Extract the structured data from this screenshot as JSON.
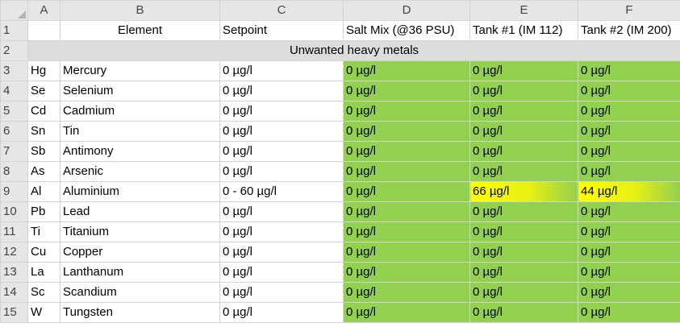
{
  "columns": [
    "A",
    "B",
    "C",
    "D",
    "E",
    "F"
  ],
  "header_row": {
    "num": "1",
    "element": "Element",
    "setpoint": "Setpoint",
    "saltmix": "Salt Mix (@36 PSU)",
    "tank1": "Tank #1 (IM 112)",
    "tank2": "Tank #2 (IM 200)"
  },
  "section_row": {
    "num": "2",
    "label": "Unwanted heavy metals"
  },
  "rows": [
    {
      "num": "3",
      "sym": "Hg",
      "name": "Mercury",
      "setpoint": "0 µg/l",
      "saltmix": "0 µg/l",
      "tank1": "0 µg/l",
      "tank2": "0 µg/l"
    },
    {
      "num": "4",
      "sym": "Se",
      "name": "Selenium",
      "setpoint": "0 µg/l",
      "saltmix": "0 µg/l",
      "tank1": "0 µg/l",
      "tank2": "0 µg/l"
    },
    {
      "num": "5",
      "sym": "Cd",
      "name": "Cadmium",
      "setpoint": "0 µg/l",
      "saltmix": "0 µg/l",
      "tank1": "0 µg/l",
      "tank2": "0 µg/l"
    },
    {
      "num": "6",
      "sym": "Sn",
      "name": "Tin",
      "setpoint": "0 µg/l",
      "saltmix": "0 µg/l",
      "tank1": "0 µg/l",
      "tank2": "0 µg/l"
    },
    {
      "num": "7",
      "sym": "Sb",
      "name": "Antimony",
      "setpoint": "0 µg/l",
      "saltmix": "0 µg/l",
      "tank1": "0 µg/l",
      "tank2": "0 µg/l"
    },
    {
      "num": "8",
      "sym": "As",
      "name": "Arsenic",
      "setpoint": "0 µg/l",
      "saltmix": "0 µg/l",
      "tank1": "0 µg/l",
      "tank2": "0 µg/l"
    },
    {
      "num": "9",
      "sym": "Al",
      "name": "Aluminium",
      "setpoint": "0 - 60 µg/l",
      "saltmix": "0 µg/l",
      "tank1": "66 µg/l",
      "tank2": "44 µg/l"
    },
    {
      "num": "10",
      "sym": "Pb",
      "name": "Lead",
      "setpoint": "0 µg/l",
      "saltmix": "0 µg/l",
      "tank1": "0 µg/l",
      "tank2": "0 µg/l"
    },
    {
      "num": "11",
      "sym": "Ti",
      "name": "Titanium",
      "setpoint": "0 µg/l",
      "saltmix": "0 µg/l",
      "tank1": "0 µg/l",
      "tank2": "0 µg/l"
    },
    {
      "num": "12",
      "sym": "Cu",
      "name": "Copper",
      "setpoint": "0 µg/l",
      "saltmix": "0 µg/l",
      "tank1": "0 µg/l",
      "tank2": "0 µg/l"
    },
    {
      "num": "13",
      "sym": "La",
      "name": "Lanthanum",
      "setpoint": "0 µg/l",
      "saltmix": "0 µg/l",
      "tank1": "0 µg/l",
      "tank2": "0 µg/l"
    },
    {
      "num": "14",
      "sym": "Sc",
      "name": "Scandium",
      "setpoint": "0 µg/l",
      "saltmix": "0 µg/l",
      "tank1": "0 µg/l",
      "tank2": "0 µg/l"
    },
    {
      "num": "15",
      "sym": "W",
      "name": "Tungsten",
      "setpoint": "0 µg/l",
      "saltmix": "0 µg/l",
      "tank1": "0 µg/l",
      "tank2": "0 µg/l"
    }
  ],
  "colors": {
    "ok": "#92d050",
    "warn": "#ffff00",
    "section": "#dcdcdc",
    "header": "#e6e6e6"
  }
}
